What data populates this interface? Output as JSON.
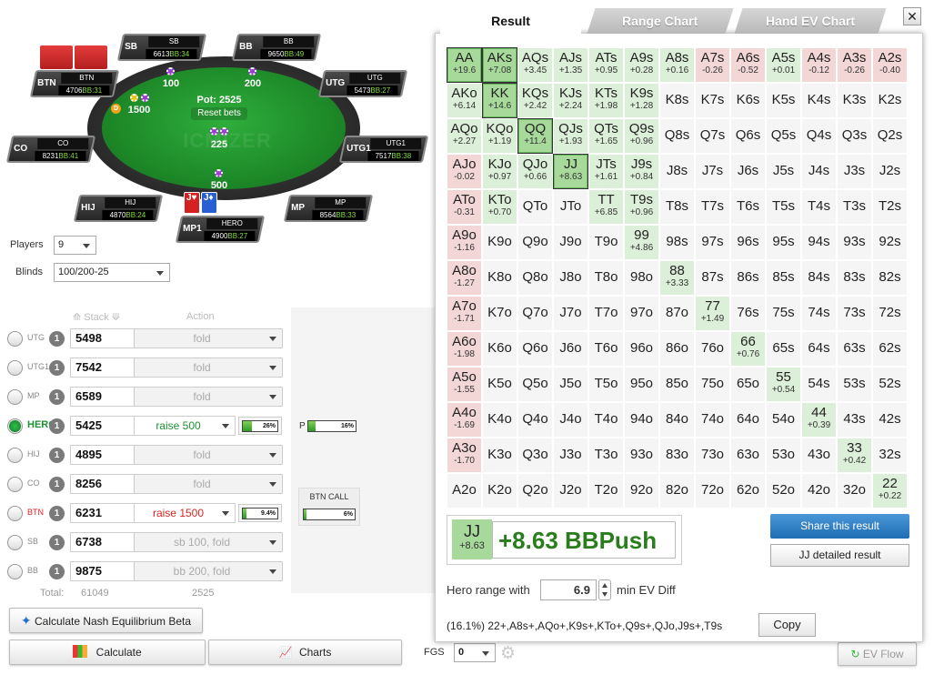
{
  "table": {
    "pot": "Pot: 2525",
    "reset_bets": "Reset bets",
    "watermark": "ICMIZER",
    "bets": {
      "btn": "1500",
      "sb": "100",
      "bb": "200",
      "pot_chip": "225",
      "hero": "500"
    },
    "hero_cards": [
      "J♥",
      "J♦"
    ],
    "seats": [
      {
        "key": "sb",
        "short": "SB",
        "label": "SB",
        "stack": "6613",
        "bb": "BB:34"
      },
      {
        "key": "bb",
        "short": "BB",
        "label": "BB",
        "stack": "9650",
        "bb": "BB:49"
      },
      {
        "key": "btn",
        "short": "BTN",
        "label": "BTN",
        "stack": "4706",
        "bb": "BB:31"
      },
      {
        "key": "utg",
        "short": "UTG",
        "label": "UTG",
        "stack": "5473",
        "bb": "BB:27"
      },
      {
        "key": "co",
        "short": "CO",
        "label": "CO",
        "stack": "8231",
        "bb": "BB:41"
      },
      {
        "key": "utg1",
        "short": "UTG1",
        "label": "UTG1",
        "stack": "7517",
        "bb": "BB:38"
      },
      {
        "key": "hij",
        "short": "HIJ",
        "label": "HIJ",
        "stack": "4870",
        "bb": "BB:24"
      },
      {
        "key": "mp",
        "short": "MP",
        "label": "MP",
        "stack": "8564",
        "bb": "BB:33"
      },
      {
        "key": "hero",
        "short": "MP1",
        "label": "HERO",
        "stack": "4900",
        "bb": "BB:27"
      }
    ]
  },
  "settings": {
    "players_label": "Players",
    "players_value": "9",
    "blinds_label": "Blinds",
    "blinds_value": "100/200-25",
    "stack_header": "Stack",
    "action_header": "Action"
  },
  "rows": [
    {
      "pos": "UTG",
      "count": "1",
      "stack": "5498",
      "action": "fold",
      "active": false,
      "hero": false
    },
    {
      "pos": "UTG1",
      "count": "1",
      "stack": "7542",
      "action": "fold",
      "active": false,
      "hero": false
    },
    {
      "pos": "MP",
      "count": "1",
      "stack": "6589",
      "action": "fold",
      "active": false,
      "hero": false
    },
    {
      "pos": "HERO",
      "count": "1",
      "stack": "5425",
      "action": "raise 500",
      "active": true,
      "hero": true,
      "pct": "26%",
      "fill": 0.26
    },
    {
      "pos": "HIJ",
      "count": "1",
      "stack": "4895",
      "action": "fold",
      "active": false,
      "hero": false
    },
    {
      "pos": "CO",
      "count": "1",
      "stack": "8256",
      "action": "fold",
      "active": false,
      "hero": false
    },
    {
      "pos": "BTN",
      "count": "1",
      "stack": "6231",
      "action": "raise 1500",
      "active": true,
      "hero": false,
      "pct": "9.4%",
      "fill": 0.094
    },
    {
      "pos": "SB",
      "count": "1",
      "stack": "6738",
      "action": "sb 100, fold",
      "active": false,
      "hero": false
    },
    {
      "pos": "BB",
      "count": "1",
      "stack": "9875",
      "action": "bb 200, fold",
      "active": false,
      "hero": false
    }
  ],
  "totals": {
    "label": "Total:",
    "stack": "61049",
    "pot": "2525"
  },
  "tree": {
    "p_label": "P",
    "p_pct": "16%",
    "p_fill": 0.16,
    "btn_call_label": "BTN CALL",
    "btn_call_pct": "6%",
    "btn_call_fill": 0.06
  },
  "buttons": {
    "nash": "Calculate Nash Equilibrium Beta",
    "calculate": "Calculate",
    "charts": "Charts",
    "fgs_label": "FGS",
    "fgs_value": "0",
    "ev_flow": "EV Flow"
  },
  "tabs": [
    "Result",
    "Range Chart",
    "Hand EV Chart"
  ],
  "close": "✕",
  "grid": [
    [
      [
        "AA",
        "+19.6",
        "h"
      ],
      [
        "AKs",
        "+7.08",
        "h"
      ],
      [
        "AQs",
        "+3.45",
        "p"
      ],
      [
        "AJs",
        "+1.35",
        "p"
      ],
      [
        "ATs",
        "+0.95",
        "p"
      ],
      [
        "A9s",
        "+0.28",
        "p"
      ],
      [
        "A8s",
        "+0.16",
        "p"
      ],
      [
        "A7s",
        "-0.26",
        "n"
      ],
      [
        "A6s",
        "-0.52",
        "n"
      ],
      [
        "A5s",
        "+0.01",
        "p"
      ],
      [
        "A4s",
        "-0.12",
        "n"
      ],
      [
        "A3s",
        "-0.26",
        "n"
      ],
      [
        "A2s",
        "-0.40",
        "n"
      ]
    ],
    [
      [
        "AKo",
        "+6.14",
        "p"
      ],
      [
        "KK",
        "+14.6",
        "h"
      ],
      [
        "KQs",
        "+2.42",
        "p"
      ],
      [
        "KJs",
        "+2.24",
        "p"
      ],
      [
        "KTs",
        "+1.98",
        "p"
      ],
      [
        "K9s",
        "+1.28",
        "p"
      ],
      [
        "K8s",
        "",
        ""
      ],
      [
        "K7s",
        "",
        ""
      ],
      [
        "K6s",
        "",
        ""
      ],
      [
        "K5s",
        "",
        ""
      ],
      [
        "K4s",
        "",
        ""
      ],
      [
        "K3s",
        "",
        ""
      ],
      [
        "K2s",
        "",
        ""
      ]
    ],
    [
      [
        "AQo",
        "+2.27",
        "p"
      ],
      [
        "KQo",
        "+1.19",
        "p"
      ],
      [
        "QQ",
        "+11.4",
        "h"
      ],
      [
        "QJs",
        "+1.93",
        "p"
      ],
      [
        "QTs",
        "+1.65",
        "p"
      ],
      [
        "Q9s",
        "+0.96",
        "p"
      ],
      [
        "Q8s",
        "",
        ""
      ],
      [
        "Q7s",
        "",
        ""
      ],
      [
        "Q6s",
        "",
        ""
      ],
      [
        "Q5s",
        "",
        ""
      ],
      [
        "Q4s",
        "",
        ""
      ],
      [
        "Q3s",
        "",
        ""
      ],
      [
        "Q2s",
        "",
        ""
      ]
    ],
    [
      [
        "AJo",
        "-0.02",
        "n"
      ],
      [
        "KJo",
        "+0.97",
        "p"
      ],
      [
        "QJo",
        "+0.66",
        "p"
      ],
      [
        "JJ",
        "+8.63",
        "h"
      ],
      [
        "JTs",
        "+1.61",
        "p"
      ],
      [
        "J9s",
        "+0.84",
        "p"
      ],
      [
        "J8s",
        "",
        ""
      ],
      [
        "J7s",
        "",
        ""
      ],
      [
        "J6s",
        "",
        ""
      ],
      [
        "J5s",
        "",
        ""
      ],
      [
        "J4s",
        "",
        ""
      ],
      [
        "J3s",
        "",
        ""
      ],
      [
        "J2s",
        "",
        ""
      ]
    ],
    [
      [
        "ATo",
        "-0.31",
        "n"
      ],
      [
        "KTo",
        "+0.70",
        "p"
      ],
      [
        "QTo",
        "",
        ""
      ],
      [
        "JTo",
        "",
        ""
      ],
      [
        "TT",
        "+6.85",
        "p"
      ],
      [
        "T9s",
        "+0.96",
        "p"
      ],
      [
        "T8s",
        "",
        ""
      ],
      [
        "T7s",
        "",
        ""
      ],
      [
        "T6s",
        "",
        ""
      ],
      [
        "T5s",
        "",
        ""
      ],
      [
        "T4s",
        "",
        ""
      ],
      [
        "T3s",
        "",
        ""
      ],
      [
        "T2s",
        "",
        ""
      ]
    ],
    [
      [
        "A9o",
        "-1.16",
        "n"
      ],
      [
        "K9o",
        "",
        ""
      ],
      [
        "Q9o",
        "",
        ""
      ],
      [
        "J9o",
        "",
        ""
      ],
      [
        "T9o",
        "",
        ""
      ],
      [
        "99",
        "+4.86",
        "p"
      ],
      [
        "98s",
        "",
        ""
      ],
      [
        "97s",
        "",
        ""
      ],
      [
        "96s",
        "",
        ""
      ],
      [
        "95s",
        "",
        ""
      ],
      [
        "94s",
        "",
        ""
      ],
      [
        "93s",
        "",
        ""
      ],
      [
        "92s",
        "",
        ""
      ]
    ],
    [
      [
        "A8o",
        "-1.27",
        "n"
      ],
      [
        "K8o",
        "",
        ""
      ],
      [
        "Q8o",
        "",
        ""
      ],
      [
        "J8o",
        "",
        ""
      ],
      [
        "T8o",
        "",
        ""
      ],
      [
        "98o",
        "",
        ""
      ],
      [
        "88",
        "+3.33",
        "p"
      ],
      [
        "87s",
        "",
        ""
      ],
      [
        "86s",
        "",
        ""
      ],
      [
        "85s",
        "",
        ""
      ],
      [
        "84s",
        "",
        ""
      ],
      [
        "83s",
        "",
        ""
      ],
      [
        "82s",
        "",
        ""
      ]
    ],
    [
      [
        "A7o",
        "-1.71",
        "n"
      ],
      [
        "K7o",
        "",
        ""
      ],
      [
        "Q7o",
        "",
        ""
      ],
      [
        "J7o",
        "",
        ""
      ],
      [
        "T7o",
        "",
        ""
      ],
      [
        "97o",
        "",
        ""
      ],
      [
        "87o",
        "",
        ""
      ],
      [
        "77",
        "+1.49",
        "p"
      ],
      [
        "76s",
        "",
        ""
      ],
      [
        "75s",
        "",
        ""
      ],
      [
        "74s",
        "",
        ""
      ],
      [
        "73s",
        "",
        ""
      ],
      [
        "72s",
        "",
        ""
      ]
    ],
    [
      [
        "A6o",
        "-1.98",
        "n"
      ],
      [
        "K6o",
        "",
        ""
      ],
      [
        "Q6o",
        "",
        ""
      ],
      [
        "J6o",
        "",
        ""
      ],
      [
        "T6o",
        "",
        ""
      ],
      [
        "96o",
        "",
        ""
      ],
      [
        "86o",
        "",
        ""
      ],
      [
        "76o",
        "",
        ""
      ],
      [
        "66",
        "+0.76",
        "p"
      ],
      [
        "65s",
        "",
        ""
      ],
      [
        "64s",
        "",
        ""
      ],
      [
        "63s",
        "",
        ""
      ],
      [
        "62s",
        "",
        ""
      ]
    ],
    [
      [
        "A5o",
        "-1.55",
        "n"
      ],
      [
        "K5o",
        "",
        ""
      ],
      [
        "Q5o",
        "",
        ""
      ],
      [
        "J5o",
        "",
        ""
      ],
      [
        "T5o",
        "",
        ""
      ],
      [
        "95o",
        "",
        ""
      ],
      [
        "85o",
        "",
        ""
      ],
      [
        "75o",
        "",
        ""
      ],
      [
        "65o",
        "",
        ""
      ],
      [
        "55",
        "+0.54",
        "p"
      ],
      [
        "54s",
        "",
        ""
      ],
      [
        "53s",
        "",
        ""
      ],
      [
        "52s",
        "",
        ""
      ]
    ],
    [
      [
        "A4o",
        "-1.69",
        "n"
      ],
      [
        "K4o",
        "",
        ""
      ],
      [
        "Q4o",
        "",
        ""
      ],
      [
        "J4o",
        "",
        ""
      ],
      [
        "T4o",
        "",
        ""
      ],
      [
        "94o",
        "",
        ""
      ],
      [
        "84o",
        "",
        ""
      ],
      [
        "74o",
        "",
        ""
      ],
      [
        "64o",
        "",
        ""
      ],
      [
        "54o",
        "",
        ""
      ],
      [
        "44",
        "+0.39",
        "p"
      ],
      [
        "43s",
        "",
        ""
      ],
      [
        "42s",
        "",
        ""
      ]
    ],
    [
      [
        "A3o",
        "-1.70",
        "n"
      ],
      [
        "K3o",
        "",
        ""
      ],
      [
        "Q3o",
        "",
        ""
      ],
      [
        "J3o",
        "",
        ""
      ],
      [
        "T3o",
        "",
        ""
      ],
      [
        "93o",
        "",
        ""
      ],
      [
        "83o",
        "",
        ""
      ],
      [
        "73o",
        "",
        ""
      ],
      [
        "63o",
        "",
        ""
      ],
      [
        "53o",
        "",
        ""
      ],
      [
        "43o",
        "",
        ""
      ],
      [
        "33",
        "+0.42",
        "p"
      ],
      [
        "32s",
        "",
        ""
      ]
    ],
    [
      [
        "A2o",
        "",
        ""
      ],
      [
        "K2o",
        "",
        ""
      ],
      [
        "Q2o",
        "",
        ""
      ],
      [
        "J2o",
        "",
        ""
      ],
      [
        "T2o",
        "",
        ""
      ],
      [
        "92o",
        "",
        ""
      ],
      [
        "82o",
        "",
        ""
      ],
      [
        "72o",
        "",
        ""
      ],
      [
        "62o",
        "",
        ""
      ],
      [
        "52o",
        "",
        ""
      ],
      [
        "42o",
        "",
        ""
      ],
      [
        "32o",
        "",
        ""
      ],
      [
        "22",
        "+0.22",
        "p"
      ]
    ]
  ],
  "selected": {
    "hand": "JJ",
    "ev": "+8.63",
    "result": "+8.63 BBPush"
  },
  "share_label": "Share this result",
  "detail_label": "JJ detailed result",
  "hero_range_label": "Hero range with",
  "hero_range_value": "6.9",
  "min_ev_label": "min EV Diff",
  "range_text": "(16.1%) 22+,A8s+,AQo+,K9s+,KTo+,Q9s+,QJo,J9s+,T9s",
  "copy_label": "Copy",
  "colors": {
    "accent_green": "#2a7d1c",
    "positive": "#dcefd8",
    "negative": "#f3d6d6",
    "highlight": "#a6d99a",
    "share": "#1f6db3"
  }
}
